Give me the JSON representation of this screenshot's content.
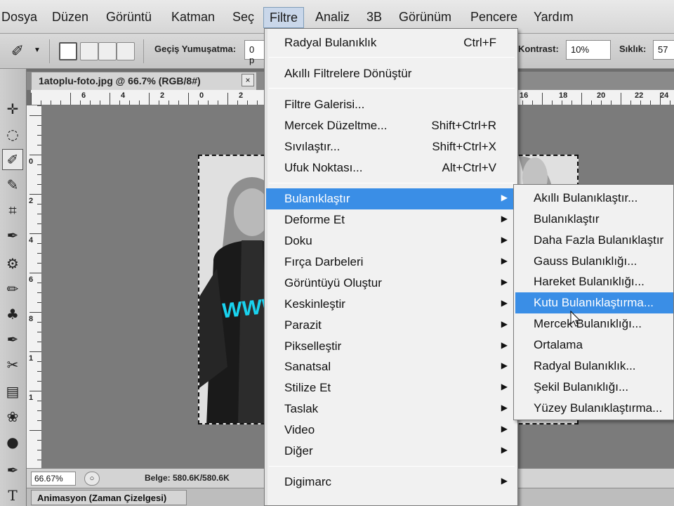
{
  "menubar": {
    "items": [
      "Dosya",
      "Düzen",
      "Görüntü",
      "Katman",
      "Seç",
      "Filtre",
      "Analiz",
      "3B",
      "Görünüm",
      "Pencere",
      "Yardım"
    ],
    "active": "Filtre"
  },
  "options": {
    "feather_label": "Geçiş Yumuşatma:",
    "feather_value": "0 p",
    "contrast_label": "Kontrast:",
    "contrast_value": "10%",
    "frequency_label": "Sıklık:",
    "frequency_value": "57"
  },
  "document": {
    "tab_title": "1atoplu-foto.jpg @ 66.7% (RGB/8#)",
    "close_symbol": "×",
    "photo_text": "WWW"
  },
  "rulers": {
    "top": [
      "6",
      "4",
      "2",
      "0",
      "2",
      "16",
      "18",
      "20",
      "22",
      "24",
      "2"
    ],
    "left": [
      "0",
      "2",
      "4",
      "6",
      "8",
      "1",
      "1"
    ]
  },
  "status": {
    "zoom": "66.67%",
    "doc_size": "Belge: 580.6K/580.6K",
    "panel_tab": "Animasyon (Zaman Çizelgesi)"
  },
  "filter_menu": {
    "items": [
      {
        "label": "Radyal Bulanıklık",
        "shortcut": "Ctrl+F"
      },
      {
        "label": "Akıllı Filtrelere Dönüştür",
        "shortcut": ""
      },
      {
        "label": "Filtre Galerisi...",
        "shortcut": ""
      },
      {
        "label": "Mercek Düzeltme...",
        "shortcut": "Shift+Ctrl+R"
      },
      {
        "label": "Sıvılaştır...",
        "shortcut": "Shift+Ctrl+X"
      },
      {
        "label": "Ufuk Noktası...",
        "shortcut": "Alt+Ctrl+V"
      },
      {
        "label": "Bulanıklaştır",
        "submenu": true,
        "highlighted": true
      },
      {
        "label": "Deforme Et",
        "submenu": true
      },
      {
        "label": "Doku",
        "submenu": true
      },
      {
        "label": "Fırça Darbeleri",
        "submenu": true
      },
      {
        "label": "Görüntüyü Oluştur",
        "submenu": true
      },
      {
        "label": "Keskinleştir",
        "submenu": true
      },
      {
        "label": "Parazit",
        "submenu": true
      },
      {
        "label": "Pikselleştir",
        "submenu": true
      },
      {
        "label": "Sanatsal",
        "submenu": true
      },
      {
        "label": "Stilize Et",
        "submenu": true
      },
      {
        "label": "Taslak",
        "submenu": true
      },
      {
        "label": "Video",
        "submenu": true
      },
      {
        "label": "Diğer",
        "submenu": true
      },
      {
        "label": "Digimarc",
        "submenu": true
      }
    ]
  },
  "blur_submenu": {
    "items": [
      "Akıllı Bulanıklaştır...",
      "Bulanıklaştır",
      "Daha Fazla Bulanıklaştır",
      "Gauss Bulanıklığı...",
      "Hareket Bulanıklığı...",
      "Kutu Bulanıklaştırma...",
      "Mercek Bulanıklığı...",
      "Ortalama",
      "Radyal Bulanıklık...",
      "Şekil Bulanıklığı...",
      "Yüzey Bulanıklaştırma..."
    ],
    "highlighted": "Kutu Bulanıklaştırma..."
  },
  "colors": {
    "highlight": "#3a8ee6",
    "photo_text": "#19d3ef"
  }
}
